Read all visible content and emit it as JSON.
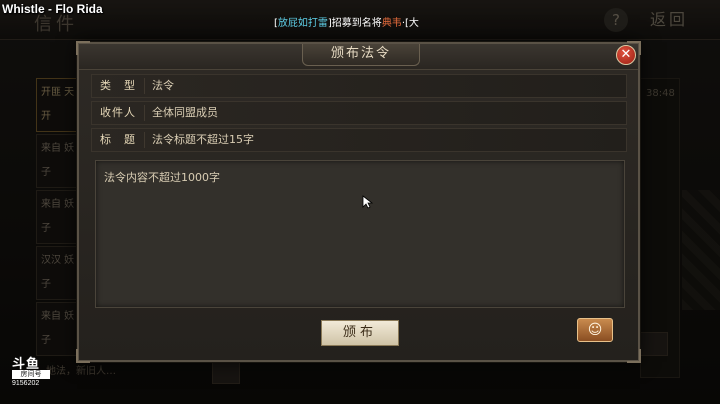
{
  "overlay": {
    "song_title": "Whistle - Flo Rida",
    "watermark": {
      "logo": "斗鱼",
      "label": "房间号",
      "room_id": "9156202"
    }
  },
  "background": {
    "title": "信件",
    "help_glyph": "?",
    "back_label": "返回",
    "list_items": [
      "开匪 天开",
      "来自 妖子",
      "来自 妖子",
      "汉汉 妖子",
      "来自 妖子"
    ],
    "time_text": "38:48",
    "bottom_text": "…地法，新旧人…"
  },
  "dialog": {
    "title": "颁布法令",
    "close_glyph": "✕",
    "ticker": {
      "prefix": "[",
      "name": "放屁如打雷",
      "mid": "]招募到名将",
      "hero": "典韦",
      "suffix": "·[大"
    },
    "fields": {
      "type_label": "类　型",
      "type_value": "法令",
      "recipient_label": "收件人",
      "recipient_value": "全体同盟成员",
      "subject_label": "标　题",
      "subject_placeholder": "法令标题不超过15字"
    },
    "content_placeholder": "法令内容不超过1000字",
    "publish_label": "颁布",
    "emoji_icon": "smile-icon"
  },
  "colors": {
    "accent_gold": "#e6d8b8",
    "ticker_name": "#5fd0e8",
    "ticker_hero": "#e46b3c",
    "close_red": "#c0392b"
  }
}
